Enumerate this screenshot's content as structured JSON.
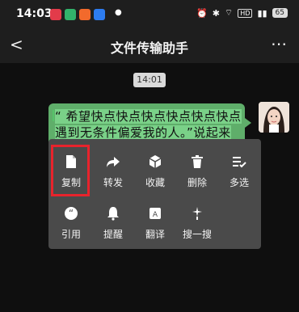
{
  "status_bar": {
    "time": "14:03",
    "battery": "65",
    "network": "HD"
  },
  "header": {
    "title": "文件传输助手"
  },
  "chat": {
    "timestamp": "14:01",
    "message": "“ 希望快点快点快点快点快点快点遇到无条件偏爱我的人。”说起来也奇怪 莫名就遇见了 莫名就玩到一起 莫名的还有相同的爱好 莫名的一下过了好几年"
  },
  "menu": {
    "row1": [
      "复制",
      "转发",
      "收藏",
      "删除",
      "多选"
    ],
    "row2": [
      "引用",
      "提醒",
      "翻译",
      "搜一搜"
    ]
  },
  "colors": {
    "bubble": "#5fae6a",
    "menu": "#4a4a4a",
    "highlight": "#e8232c"
  }
}
